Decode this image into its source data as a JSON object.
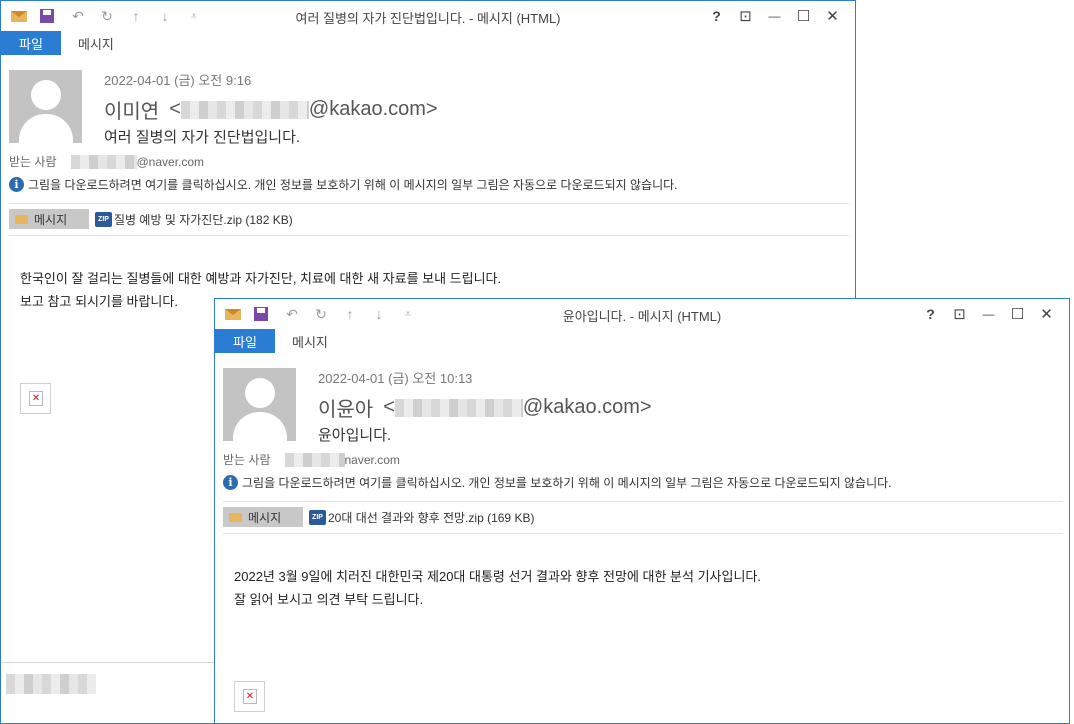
{
  "window1": {
    "title": "여러 질병의 자가 진단법입니다. - 메시지 (HTML)",
    "tab_file": "파일",
    "tab_message": "메시지",
    "date": "2022-04-01 (금) 오전 9:16",
    "sender_name": "이미연",
    "sender_email_prefix": "<",
    "sender_email_suffix": "@kakao.com>",
    "subject": "여러 질병의 자가 진단법입니다.",
    "to_label": "받는 사람",
    "to_email_suffix": "@naver.com",
    "info_bar": "그림을 다운로드하려면 여기를 클릭하십시오. 개인 정보를 보호하기 위해 이 메시지의 일부 그림은 자동으로 다운로드되지 않습니다.",
    "attach_msg_label": "메시지",
    "attachment": "질병 예방 및 자가진단.zip (182 KB)",
    "body_lines": [
      "한국인이 잘 걸리는 질병들에 대한 예방과 자가진단, 치료에 대한 새 자료를 보내 드립니다.",
      "보고 참고 되시기를 바랍니다."
    ]
  },
  "window2": {
    "title": "윤아입니다. - 메시지 (HTML)",
    "tab_file": "파일",
    "tab_message": "메시지",
    "date": "2022-04-01 (금) 오전 10:13",
    "sender_name": "이윤아",
    "sender_email_prefix": "<",
    "sender_email_suffix": "@kakao.com>",
    "subject": "윤아입니다.",
    "to_label": "받는 사람",
    "to_email_suffix": "naver.com",
    "info_bar": "그림을 다운로드하려면 여기를 클릭하십시오. 개인 정보를 보호하기 위해 이 메시지의 일부 그림은 자동으로 다운로드되지 않습니다.",
    "attach_msg_label": "메시지",
    "attachment": "20대 대선 결과와 향후 전망.zip (169 KB)",
    "body_lines": [
      "2022년 3월 9일에 치러진 대한민국 제20대 대통령 선거 결과와 향후 전망에 대한 분석 기사입니다.",
      "잘 읽어 보시고 의견 부탁 드립니다."
    ]
  },
  "icons": {
    "help": "?",
    "restore_ribbon": "⊡",
    "minimize": "—",
    "maximize": "☐",
    "close": "✕",
    "undo": "↶",
    "redo": "↻",
    "up": "↑",
    "down": "↓",
    "customize": "⩡",
    "info": "i",
    "zip": "ZIP"
  }
}
